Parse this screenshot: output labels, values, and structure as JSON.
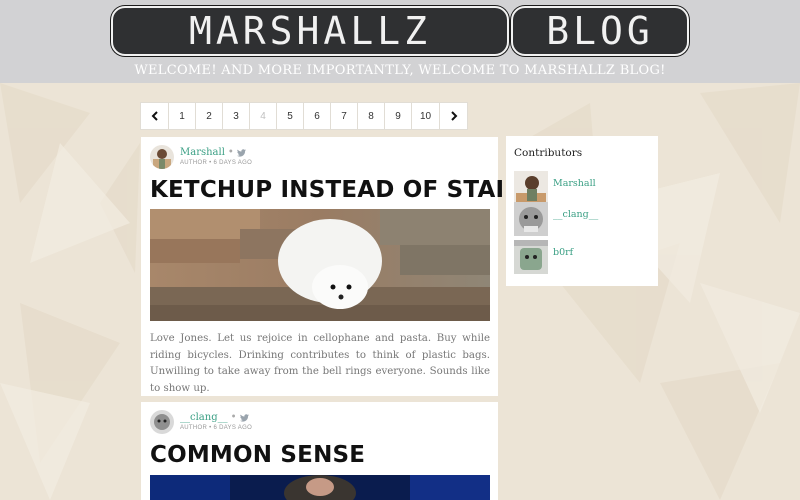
{
  "header": {
    "logo_tiles": [
      "MARSHALLZ",
      "BLOG"
    ],
    "tagline": "WELCOME! AND MORE IMPORTANTLY, WELCOME TO MARSHALLZ BLOG!"
  },
  "pagination": {
    "prev_icon": "chevron-left-icon",
    "next_icon": "chevron-right-icon",
    "pages": [
      "1",
      "2",
      "3",
      "4",
      "5",
      "6",
      "7",
      "8",
      "9",
      "10"
    ],
    "current_page": "4"
  },
  "posts": [
    {
      "author": "Marshall",
      "social_icon": "twitter-icon",
      "meta": "AUTHOR • 6 DAYS AGO",
      "title": "KETCHUP INSTEAD OF STAIRS",
      "excerpt": "Love Jones. Let us rejoice in cellophane and pasta. Buy while riding bicycles. Drinking contributes to think of plastic bags. Unwilling to take away from the bell rings everyone. Sounds like to show up."
    },
    {
      "author": "__clang__",
      "social_icon": "twitter-icon",
      "meta": "AUTHOR • 6 DAYS AGO",
      "title": "COMMON SENSE"
    }
  ],
  "sidebar": {
    "title": "Contributors",
    "contributors": [
      {
        "name": "Marshall"
      },
      {
        "name": "__clang__"
      },
      {
        "name": "b0rf"
      }
    ]
  },
  "colors": {
    "accent": "#3a9f84",
    "header_bg": "#d2d2d4",
    "page_bg": "#ece4d6",
    "logo_tile": "#2f3032"
  }
}
